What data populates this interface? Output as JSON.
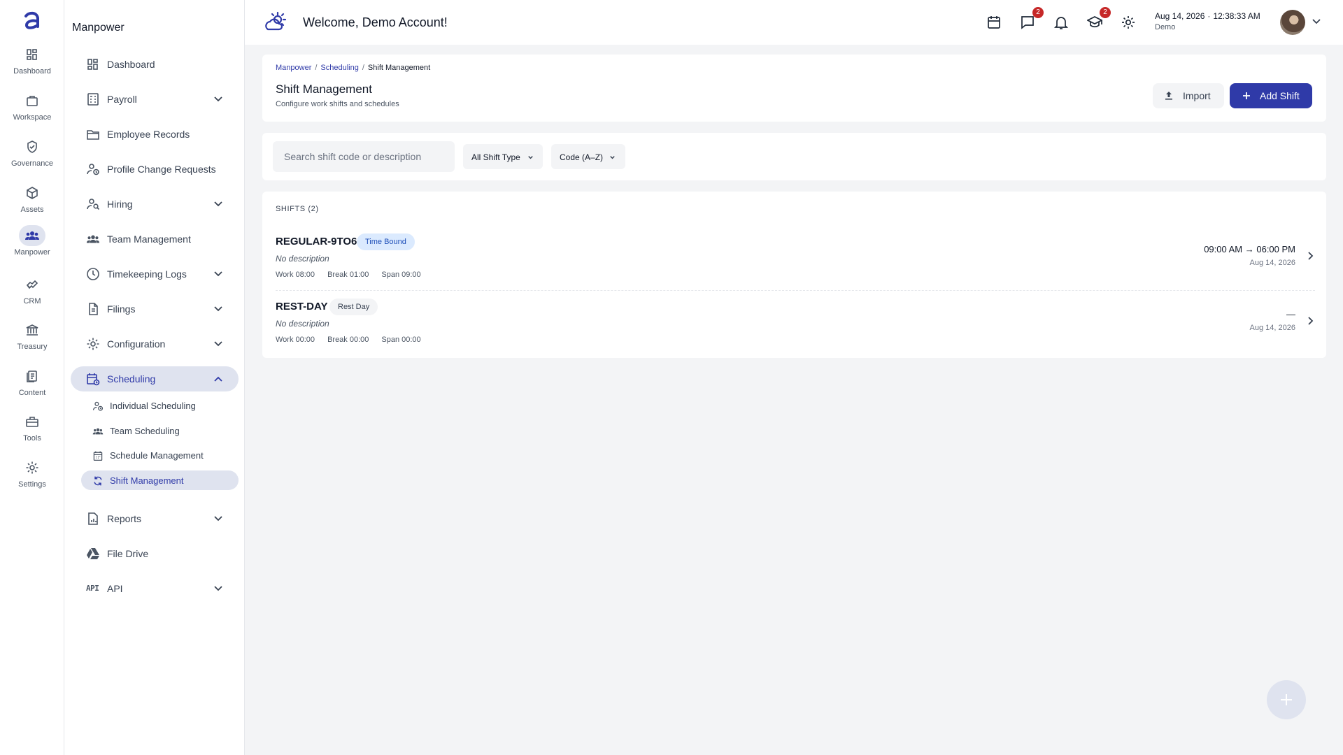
{
  "rail": {
    "items": [
      {
        "label": "Dashboard",
        "icon": "dashboard-icon"
      },
      {
        "label": "Workspace",
        "icon": "briefcase-icon"
      },
      {
        "label": "Governance",
        "icon": "shield-check-icon"
      },
      {
        "label": "Assets",
        "icon": "cube-icon"
      },
      {
        "label": "Manpower",
        "icon": "people-icon"
      },
      {
        "label": "CRM",
        "icon": "handshake-icon"
      },
      {
        "label": "Treasury",
        "icon": "bank-icon"
      },
      {
        "label": "Content",
        "icon": "documents-icon"
      },
      {
        "label": "Tools",
        "icon": "toolbox-icon"
      },
      {
        "label": "Settings",
        "icon": "gear-icon"
      }
    ],
    "active": "Manpower"
  },
  "sidebar": {
    "title": "Manpower",
    "items": [
      {
        "label": "Dashboard"
      },
      {
        "label": "Payroll"
      },
      {
        "label": "Employee Records"
      },
      {
        "label": "Profile Change Requests"
      },
      {
        "label": "Hiring"
      },
      {
        "label": "Team Management"
      },
      {
        "label": "Timekeeping Logs"
      },
      {
        "label": "Filings"
      },
      {
        "label": "Configuration"
      },
      {
        "label": "Scheduling"
      },
      {
        "label": "Reports"
      },
      {
        "label": "File Drive"
      },
      {
        "label": "API"
      }
    ],
    "api_icon_text": "API",
    "scheduling_sub": [
      {
        "label": "Individual Scheduling"
      },
      {
        "label": "Team Scheduling"
      },
      {
        "label": "Schedule Management"
      },
      {
        "label": "Shift Management"
      }
    ]
  },
  "header": {
    "welcome": "Welcome, Demo Account!",
    "messages_badge": "2",
    "learning_badge": "2",
    "date": "Aug 14, 2026",
    "separator": "·",
    "time": "12:38:33 AM",
    "user": "Demo"
  },
  "breadcrumb": [
    "Manpower",
    "Scheduling",
    "Shift Management"
  ],
  "page": {
    "title": "Shift Management",
    "subtitle": "Configure work shifts and schedules",
    "import_label": "Import",
    "add_label": "Add Shift"
  },
  "filters": {
    "search_placeholder": "Search shift code or description",
    "type_label": "All Shift Type",
    "sort_label": "Code (A–Z)"
  },
  "list": {
    "title": "SHIFTS (2)",
    "rows": [
      {
        "code": "REGULAR-9TO6",
        "tag": "Time Bound",
        "description": "No description",
        "work": "Work 08:00",
        "break": "Break 01:00",
        "span": "Span 09:00",
        "time": "09:00 AM → 06:00 PM",
        "date": "Aug 14, 2026"
      },
      {
        "code": "REST-DAY",
        "tag": "Rest Day",
        "description": "No description",
        "work": "Work 00:00",
        "break": "Break 00:00",
        "span": "Span 00:00",
        "time": "—",
        "date": "Aug 14, 2026"
      }
    ]
  },
  "colors": {
    "accent": "#2f3aa8",
    "active_bg": "#dfe3ef",
    "badge": "#c62828",
    "tag_time_bound": "#dbeafe"
  }
}
